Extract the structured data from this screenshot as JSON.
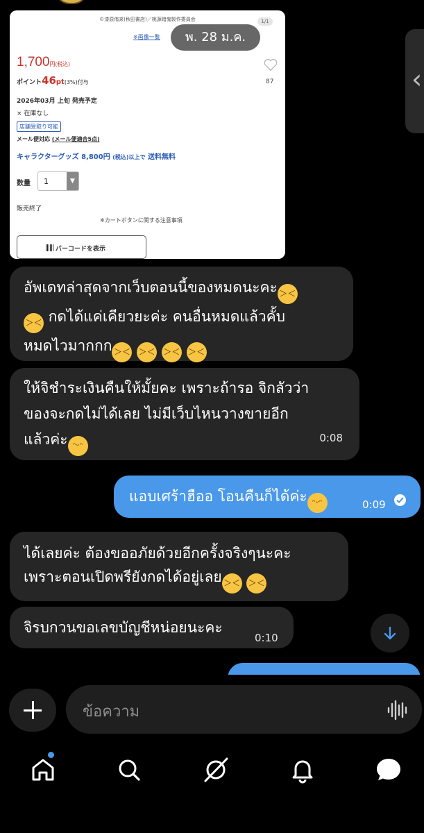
{
  "shared_image": {
    "copyright": "©漆原侑来(秋田書店)／桃源暗鬼製作委員会",
    "pager": "1/1",
    "image_list_link": "※画像一覧",
    "price": "1,700",
    "price_tax": "円(税込)",
    "points_label": "ポイント",
    "points_value": "46",
    "points_unit": "pt",
    "points_rate": "(3%)付与",
    "favorite_count": "87",
    "release": "2026年03月 上旬 発売予定",
    "stock": "× 在庫なし",
    "store_pickup_badge": "店舗受取り可能",
    "mail_label": "メール便対応",
    "mail_detail": "(メール便適合5点)",
    "free_ship_prefix": "キャラクターグッズ 8,800円",
    "free_ship_small": "(税込)以上で",
    "free_ship_suffix": "送料無料",
    "qty_label": "数量",
    "qty_value": "1",
    "sold_out": "販売終了",
    "cart_note": "※カートボタンに関する注意事項",
    "barcode_button": "バーコードを表示"
  },
  "date_separator": "พ. 28 ม.ค.",
  "messages": [
    {
      "dir": "in",
      "lines": [
        "อัพเดทล่าสุดจากเว็บตอนนี้ของหมดนะคะ",
        "กดได้แค่เคียวยะค่ะ คนอื่นหมดแล้วคั้บ",
        "หมดไวมากกก"
      ],
      "time": ""
    },
    {
      "dir": "in",
      "lines": [
        "ให้จิชำระเงินคืนให้มั้ยคะ เพราะถ้ารอ จิกลัวว่า",
        "ของจะกดไม่ได้เลย ไม่มีเว็บไหนวางขายอีก",
        "แล้วค่ะ"
      ],
      "time": "0:08"
    },
    {
      "dir": "out",
      "lines": [
        "แอบเศร้าฮืออ โอนคืนก็ได้ค่ะ"
      ],
      "time": "0:09"
    },
    {
      "dir": "in",
      "lines": [
        "ได้เลยค่ะ ต้องขออภัยด้วยอีกครั้งจริงๆนะคะ",
        "เพราะตอนเปิดพรียังกดได้อยู่เลย"
      ],
      "time": ""
    },
    {
      "dir": "in",
      "lines": [
        "จิรบกวนขอเลขบัญชีหน่อยนะคะ"
      ],
      "time": "0:10"
    }
  ],
  "composer": {
    "placeholder": "ข้อความ"
  },
  "nav": {
    "items": [
      "home-icon",
      "search-icon",
      "grok-icon",
      "bell-icon",
      "messages-icon"
    ]
  },
  "colors": {
    "outgoing": "#4a98ea",
    "incoming": "#262626",
    "accent": "#4a98ea"
  }
}
